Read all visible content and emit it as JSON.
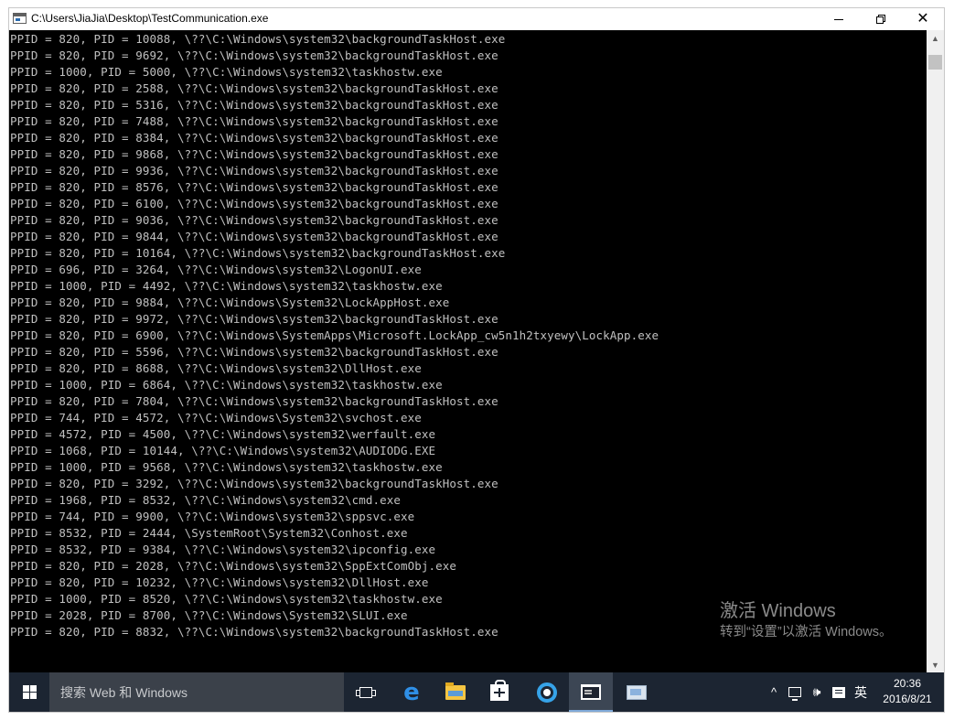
{
  "window": {
    "title": "C:\\Users\\JiaJia\\Desktop\\TestCommunication.exe",
    "minimize_label": "—",
    "close_label": "✕"
  },
  "console": {
    "lines": [
      "PPID = 820, PID = 10088, \\??\\C:\\Windows\\system32\\backgroundTaskHost.exe",
      "PPID = 820, PID = 9692, \\??\\C:\\Windows\\system32\\backgroundTaskHost.exe",
      "PPID = 1000, PID = 5000, \\??\\C:\\Windows\\system32\\taskhostw.exe",
      "PPID = 820, PID = 2588, \\??\\C:\\Windows\\system32\\backgroundTaskHost.exe",
      "PPID = 820, PID = 5316, \\??\\C:\\Windows\\system32\\backgroundTaskHost.exe",
      "PPID = 820, PID = 7488, \\??\\C:\\Windows\\system32\\backgroundTaskHost.exe",
      "PPID = 820, PID = 8384, \\??\\C:\\Windows\\system32\\backgroundTaskHost.exe",
      "PPID = 820, PID = 9868, \\??\\C:\\Windows\\system32\\backgroundTaskHost.exe",
      "PPID = 820, PID = 9936, \\??\\C:\\Windows\\system32\\backgroundTaskHost.exe",
      "PPID = 820, PID = 8576, \\??\\C:\\Windows\\system32\\backgroundTaskHost.exe",
      "PPID = 820, PID = 6100, \\??\\C:\\Windows\\system32\\backgroundTaskHost.exe",
      "PPID = 820, PID = 9036, \\??\\C:\\Windows\\system32\\backgroundTaskHost.exe",
      "PPID = 820, PID = 9844, \\??\\C:\\Windows\\system32\\backgroundTaskHost.exe",
      "PPID = 820, PID = 10164, \\??\\C:\\Windows\\system32\\backgroundTaskHost.exe",
      "PPID = 696, PID = 3264, \\??\\C:\\Windows\\system32\\LogonUI.exe",
      "PPID = 1000, PID = 4492, \\??\\C:\\Windows\\system32\\taskhostw.exe",
      "PPID = 820, PID = 9884, \\??\\C:\\Windows\\System32\\LockAppHost.exe",
      "PPID = 820, PID = 9972, \\??\\C:\\Windows\\system32\\backgroundTaskHost.exe",
      "PPID = 820, PID = 6900, \\??\\C:\\Windows\\SystemApps\\Microsoft.LockApp_cw5n1h2txyewy\\LockApp.exe",
      "PPID = 820, PID = 5596, \\??\\C:\\Windows\\system32\\backgroundTaskHost.exe",
      "PPID = 820, PID = 8688, \\??\\C:\\Windows\\system32\\DllHost.exe",
      "PPID = 1000, PID = 6864, \\??\\C:\\Windows\\system32\\taskhostw.exe",
      "PPID = 820, PID = 7804, \\??\\C:\\Windows\\system32\\backgroundTaskHost.exe",
      "PPID = 744, PID = 4572, \\??\\C:\\Windows\\System32\\svchost.exe",
      "PPID = 4572, PID = 4500, \\??\\C:\\Windows\\system32\\werfault.exe",
      "PPID = 1068, PID = 10144, \\??\\C:\\Windows\\system32\\AUDIODG.EXE",
      "PPID = 1000, PID = 9568, \\??\\C:\\Windows\\system32\\taskhostw.exe",
      "PPID = 820, PID = 3292, \\??\\C:\\Windows\\system32\\backgroundTaskHost.exe",
      "PPID = 1968, PID = 8532, \\??\\C:\\Windows\\system32\\cmd.exe",
      "PPID = 744, PID = 9900, \\??\\C:\\Windows\\system32\\sppsvc.exe",
      "PPID = 8532, PID = 2444, \\SystemRoot\\System32\\Conhost.exe",
      "PPID = 8532, PID = 9384, \\??\\C:\\Windows\\system32\\ipconfig.exe",
      "PPID = 820, PID = 2028, \\??\\C:\\Windows\\system32\\SppExtComObj.exe",
      "PPID = 820, PID = 10232, \\??\\C:\\Windows\\system32\\DllHost.exe",
      "PPID = 1000, PID = 8520, \\??\\C:\\Windows\\system32\\taskhostw.exe",
      "PPID = 2028, PID = 8700, \\??\\C:\\Windows\\System32\\SLUI.exe",
      "PPID = 820, PID = 8832, \\??\\C:\\Windows\\system32\\backgroundTaskHost.exe"
    ]
  },
  "watermark": {
    "line1": "激活 Windows",
    "line2": "转到“设置”以激活 Windows。"
  },
  "taskbar": {
    "search_placeholder": "搜索 Web 和 Windows",
    "tray_chevron": "^",
    "tray_volume": "🕪",
    "tray_ime": "英",
    "clock_time": "20:36",
    "clock_date": "2016/8/21"
  },
  "colors": {
    "console_bg": "#000000",
    "console_text": "#c0c0c0",
    "taskbar_bg": "#1c2532",
    "search_bg": "#3b414a",
    "edge_blue": "#2f8fe6"
  },
  "icons": {
    "app": "console-app-icon",
    "start": "windows-logo-icon",
    "task_view": "task-view-icon",
    "edge": "edge-browser-icon",
    "explorer": "file-explorer-icon",
    "store": "store-icon",
    "gear": "settings-gear-icon",
    "console": "console-window-icon",
    "paint": "image-viewer-icon"
  }
}
